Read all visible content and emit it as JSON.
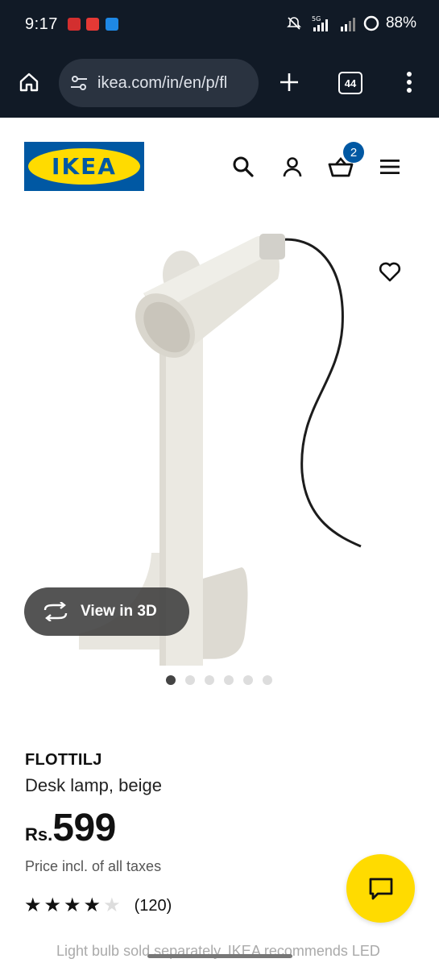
{
  "status_bar": {
    "time": "9:17",
    "network": "5G",
    "battery": "88%"
  },
  "browser": {
    "url": "ikea.com/in/en/p/fl",
    "tab_count": "44"
  },
  "header": {
    "logo_text": "IKEA",
    "cart_count": "2"
  },
  "gallery": {
    "view_3d_label": "View in 3D",
    "image_count": 6,
    "active_index": 0
  },
  "product": {
    "name": "FLOTTILJ",
    "description": "Desk lamp, beige",
    "currency": "Rs.",
    "price": "599",
    "tax_note": "Price incl. of all taxes",
    "rating": 4,
    "rating_max": 5,
    "review_count": "(120)",
    "partial_text": "Light bulb sold separately. IKEA recommends LED"
  },
  "colors": {
    "status_bg": "#111a26",
    "ikea_blue": "#0058a3",
    "ikea_yellow": "#ffdb00"
  },
  "icons": {
    "home": "home-icon",
    "site_info": "tune-icon",
    "new_tab": "plus-icon",
    "menu": "more-vert-icon",
    "search": "search-icon",
    "account": "user-icon",
    "cart": "basket-icon",
    "hamburger": "hamburger-menu-icon",
    "favorite": "heart-icon",
    "rotate": "rotate-3d-icon",
    "chat": "chat-icon"
  }
}
